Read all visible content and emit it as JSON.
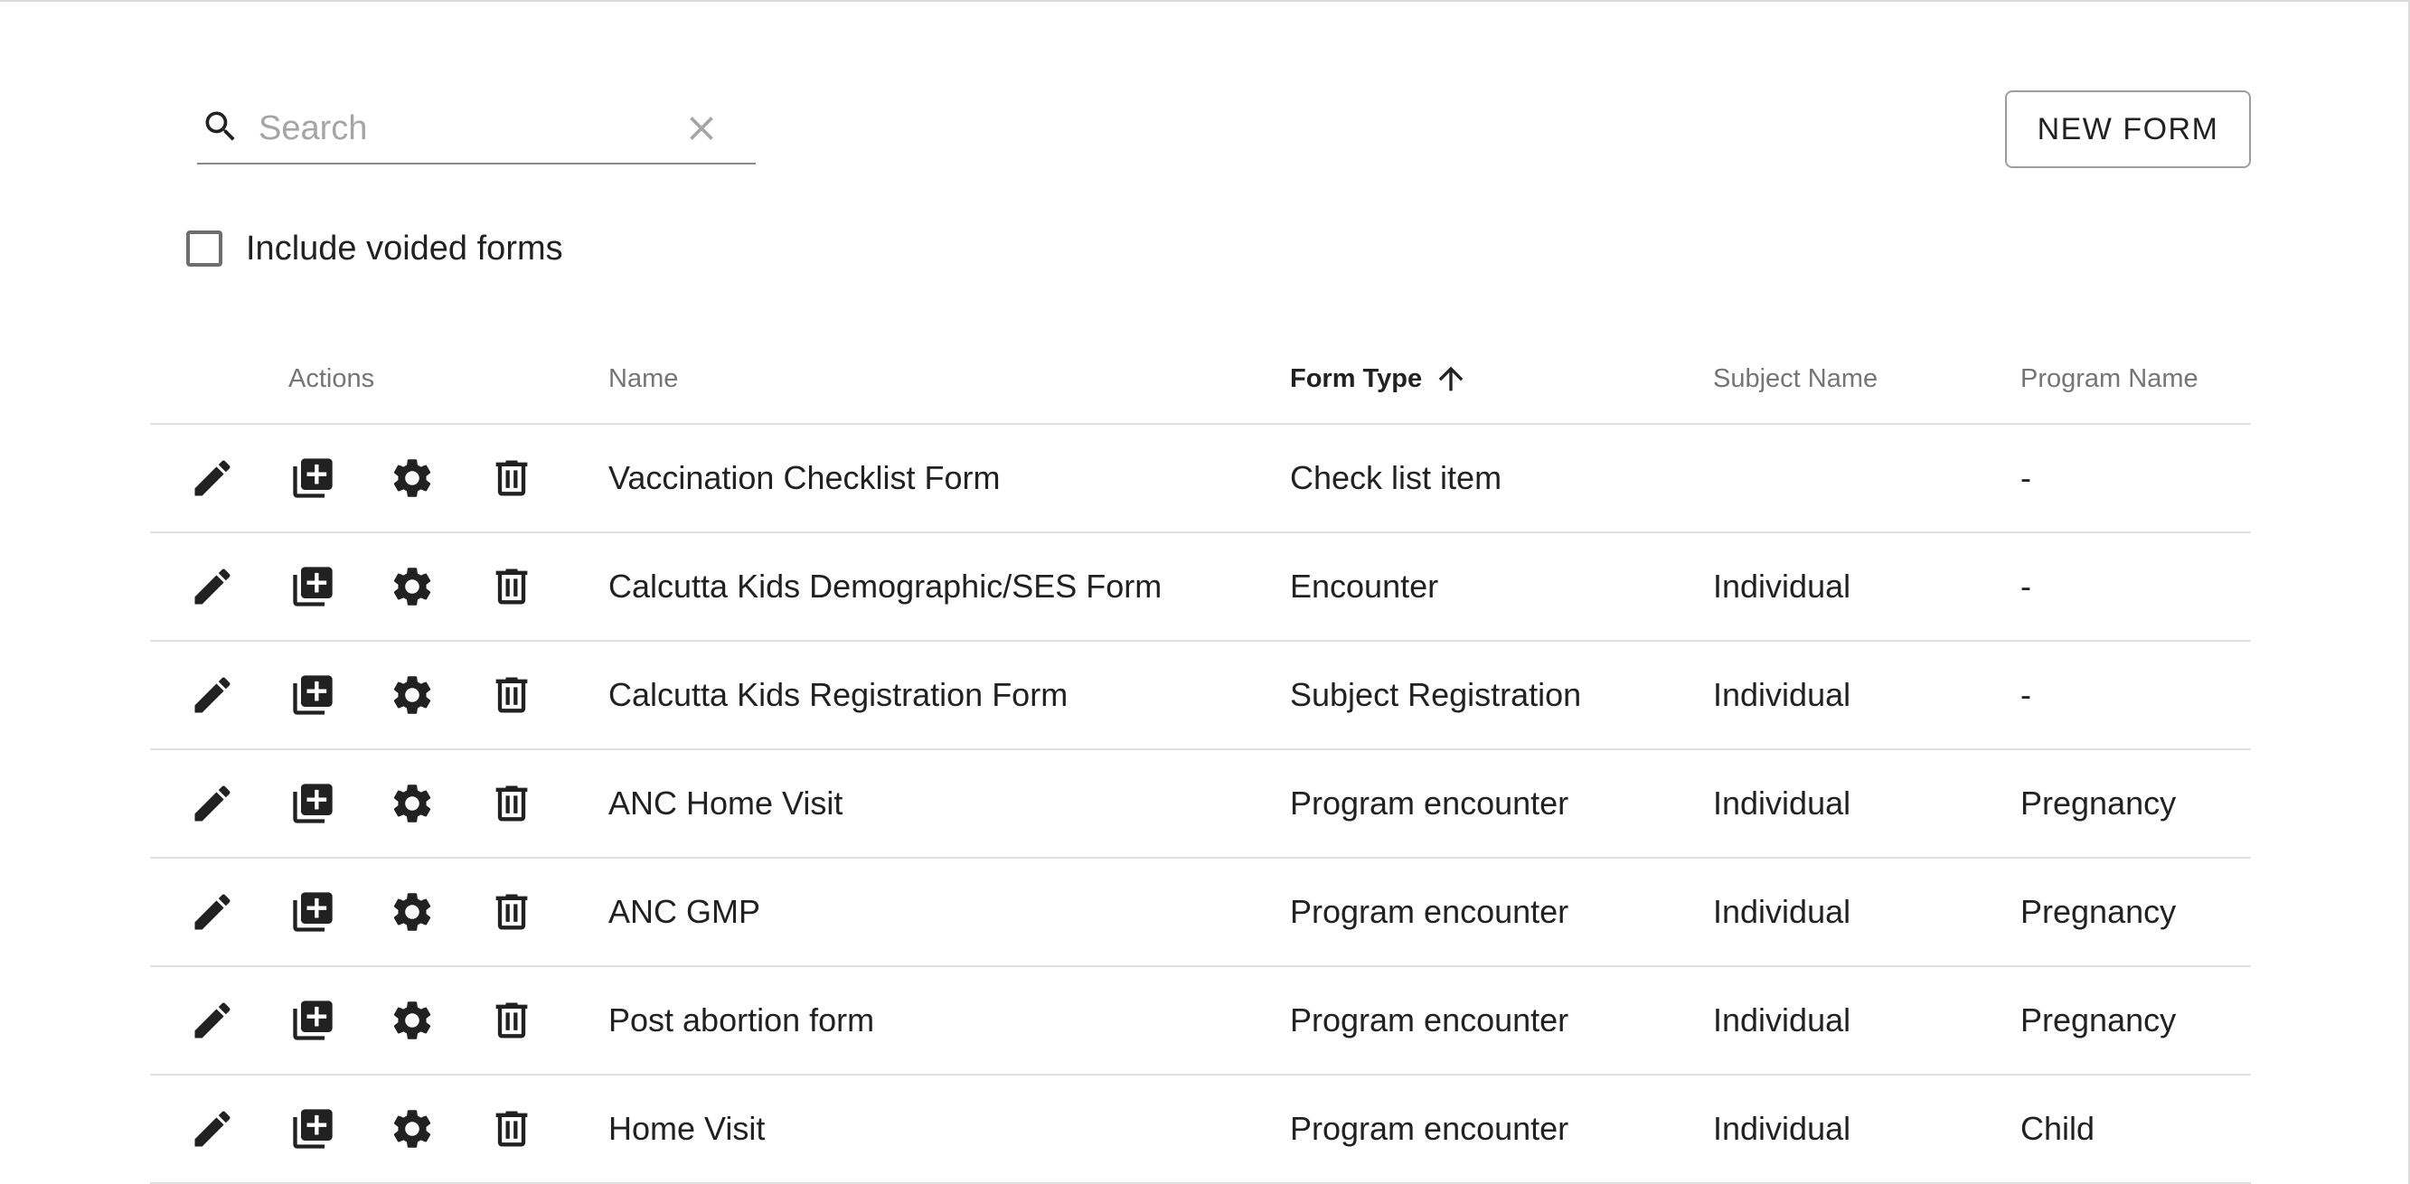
{
  "search": {
    "placeholder": "Search",
    "value": ""
  },
  "toolbar": {
    "new_form_label": "NEW FORM"
  },
  "filter": {
    "include_voided_label": "Include voided forms",
    "include_voided_checked": false
  },
  "table": {
    "headers": {
      "actions": "Actions",
      "name": "Name",
      "form_type": "Form Type",
      "subject_name": "Subject Name",
      "program_name": "Program Name"
    },
    "sort": {
      "column": "form_type",
      "direction": "ascending"
    },
    "row_actions": [
      "edit-icon",
      "duplicate-icon",
      "settings-icon",
      "delete-icon"
    ],
    "rows": [
      {
        "name": "Vaccination Checklist Form",
        "form_type": "Check list item",
        "subject_name": "",
        "program_name": "-"
      },
      {
        "name": "Calcutta Kids Demographic/SES Form",
        "form_type": "Encounter",
        "subject_name": "Individual",
        "program_name": "-"
      },
      {
        "name": "Calcutta Kids Registration Form",
        "form_type": "Subject Registration",
        "subject_name": "Individual",
        "program_name": "-"
      },
      {
        "name": "ANC Home Visit",
        "form_type": "Program encounter",
        "subject_name": "Individual",
        "program_name": "Pregnancy"
      },
      {
        "name": "ANC GMP",
        "form_type": "Program encounter",
        "subject_name": "Individual",
        "program_name": "Pregnancy"
      },
      {
        "name": "Post abortion form",
        "form_type": "Program encounter",
        "subject_name": "Individual",
        "program_name": "Pregnancy"
      },
      {
        "name": "Home Visit",
        "form_type": "Program encounter",
        "subject_name": "Individual",
        "program_name": "Child"
      }
    ]
  }
}
